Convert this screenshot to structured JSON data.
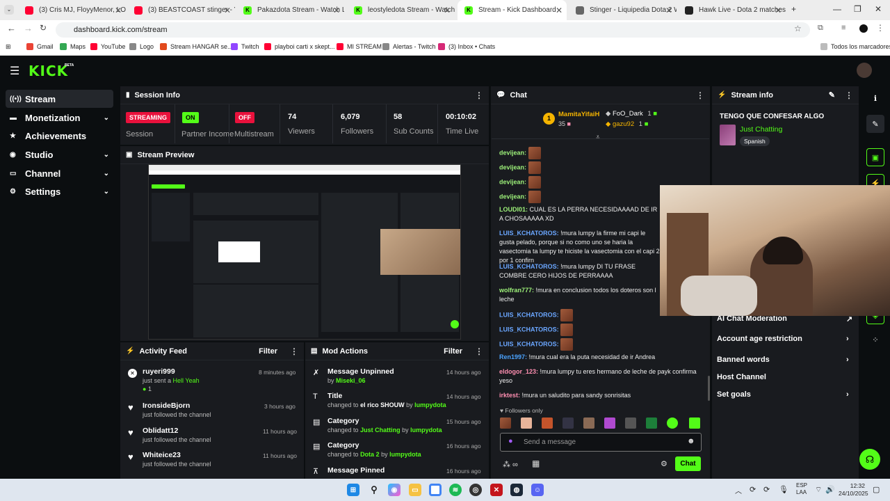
{
  "browser": {
    "tabs": [
      {
        "label": "(3) Cris MJ, FloyyMenor, LOUKI",
        "icon": "youtube-icon"
      },
      {
        "label": "(3) BEASTCOAST stinger - YouTu",
        "icon": "youtube-icon"
      },
      {
        "label": "Pakazdota Stream - Watch Live",
        "icon": "kick-icon"
      },
      {
        "label": "leostyledota Stream - Watch Li",
        "icon": "kick-icon"
      },
      {
        "label": "Stream - Kick Dashboard",
        "icon": "kick-icon"
      },
      {
        "label": "Stinger - Liquipedia Dota 2 Wi",
        "icon": "liquipedia-icon"
      },
      {
        "label": "Hawk Live - Dota 2 matches liv",
        "icon": "hawk-icon"
      }
    ],
    "url": "dashboard.kick.com/stream",
    "bookmarks": [
      "Gmail",
      "Maps",
      "YouTube",
      "Logo",
      "Stream HANGAR se...",
      "Twitch",
      "playboi carti x skept...",
      "MI STREAM",
      "Alertas - Twitch",
      "(3) Inbox • Chats"
    ],
    "all_bookmarks": "Todos los marcadores"
  },
  "app": {
    "logo": "KICK",
    "beta": "BETA"
  },
  "sidebar": {
    "items": [
      {
        "label": "Stream",
        "icon": "stream-icon"
      },
      {
        "label": "Monetization",
        "icon": "money-icon"
      },
      {
        "label": "Achievements",
        "icon": "trophy-icon"
      },
      {
        "label": "Studio",
        "icon": "studio-icon"
      },
      {
        "label": "Channel",
        "icon": "channel-icon"
      },
      {
        "label": "Settings",
        "icon": "gear-icon"
      }
    ]
  },
  "session": {
    "title": "Session Info",
    "session_badge": "STREAMING",
    "session_label": "Session",
    "partner_badge": "ON",
    "partner_label": "Partner Income",
    "multistream_badge": "OFF",
    "multistream_label": "Multistream",
    "viewers": "74",
    "viewers_label": "Viewers",
    "followers": "6,079",
    "followers_label": "Followers",
    "subs": "58",
    "subs_label": "Sub Counts",
    "time": "00:10:02",
    "time_label": "Time Live"
  },
  "preview": {
    "title": "Stream Preview"
  },
  "activity": {
    "title": "Activity Feed",
    "filter": "Filter",
    "items": [
      {
        "name": "ruyeri999",
        "desc": "just sent a",
        "gift": "Hell Yeah",
        "count": "1",
        "time": "8 minutes ago"
      },
      {
        "name": "IronsideBjorn",
        "desc": "just followed the channel",
        "time": "3 hours ago"
      },
      {
        "name": "Oblidatt12",
        "desc": "just followed the channel",
        "time": "11 hours ago"
      },
      {
        "name": "Whiteice23",
        "desc": "just followed the channel",
        "time": "11 hours ago"
      }
    ]
  },
  "mod": {
    "title": "Mod Actions",
    "filter": "Filter",
    "items": [
      {
        "title": "Message Unpinned",
        "pre": "by",
        "hl": "Miseki_06",
        "mid": "",
        "by": "",
        "time": "14 hours ago"
      },
      {
        "title": "Title",
        "pre": "changed to",
        "hl": "el rico SHOUW",
        "mid": "by",
        "by": "lumpydota",
        "time": "14 hours ago"
      },
      {
        "title": "Category",
        "pre": "changed to",
        "hl": "Just Chatting",
        "mid": "by",
        "by": "lumpydota",
        "time": "15 hours ago"
      },
      {
        "title": "Category",
        "pre": "changed to",
        "hl": "Dota 2",
        "mid": "by",
        "by": "lumpydota",
        "time": "16 hours ago"
      },
      {
        "title": "Message Pinned",
        "pre": "",
        "hl": "",
        "mid": "",
        "by": "",
        "time": "16 hours ago"
      }
    ]
  },
  "chat": {
    "title": "Chat",
    "top1": {
      "name": "MamitaYifaiH",
      "count": "35",
      "rank": "1"
    },
    "top2": {
      "name": "FoO_Dark",
      "count": "1"
    },
    "top3": {
      "name": "gazu92",
      "count": "1"
    },
    "messages": [
      {
        "user": "devijean:",
        "text": "",
        "color": "#9ef27a"
      },
      {
        "user": "devijean:",
        "text": "",
        "color": "#9ef27a"
      },
      {
        "user": "devijean:",
        "text": "",
        "color": "#9ef27a"
      },
      {
        "user": "devijean:",
        "text": "",
        "color": "#9ef27a"
      },
      {
        "user": "LOUDI01:",
        "text": " CUAL ES LA PERRA NECESIDAAAAD DE IR A CHOSAAAAA XD",
        "color": "#9ef27a"
      },
      {
        "user": "LUIS_KCHATOROS:",
        "text": " !mura lumpy la firme mi capi le gusta pelado, porque si no como uno se haria la vasectomia ta lumpy te hiciste la vasectomia con el capi 2 por 1 confirn",
        "color": "#6aa6ff"
      },
      {
        "user": "LUIS_KCHATOROS:",
        "text": " !mura lumpy DI TU FRASE COMBRE CERO HIJOS DE PERRAAAA",
        "color": "#6aa6ff"
      },
      {
        "user": "wolfran777:",
        "text": " !mura en conclusion todos los doteros son l leche",
        "color": "#9ef27a"
      },
      {
        "user": "LUIS_KCHATOROS:",
        "text": "",
        "color": "#6aa6ff"
      },
      {
        "user": "LUIS_KCHATOROS:",
        "text": "",
        "color": "#6aa6ff"
      },
      {
        "user": "LUIS_KCHATOROS:",
        "text": "",
        "color": "#6aa6ff"
      },
      {
        "user": "Ren1997:",
        "text": " !mura cual era la puta necesidad de ir Andrea",
        "color": "#4aa3ff"
      },
      {
        "user": "eldogor_123:",
        "text": " !mura lumpy tu eres hermano de leche de payk confirma yeso",
        "color": "#ff8fb1"
      },
      {
        "user": "irktest:",
        "text": " !mura un saludito para sandy sonrisitas",
        "color": "#ff8fb1"
      }
    ],
    "followers_only": "Followers only",
    "placeholder": "Send a message",
    "send": "Chat"
  },
  "stream_info": {
    "title": "Stream info",
    "stream_title": "TENGO QUE CONFESAR ALGO",
    "category": "Just Chatting",
    "language": "Spanish",
    "options": [
      "AI Chat Moderation",
      "Account age restriction",
      "Banned words",
      "Host Channel",
      "Set goals"
    ]
  },
  "taskbar": {
    "lang": "ESP",
    "lang2": "LAA",
    "time": "12:32",
    "date": "24/10/2025"
  },
  "colors": {
    "accent": "#53fc18",
    "panel": "#191b1f",
    "bg": "#0b0e10",
    "red": "#e9113c"
  }
}
